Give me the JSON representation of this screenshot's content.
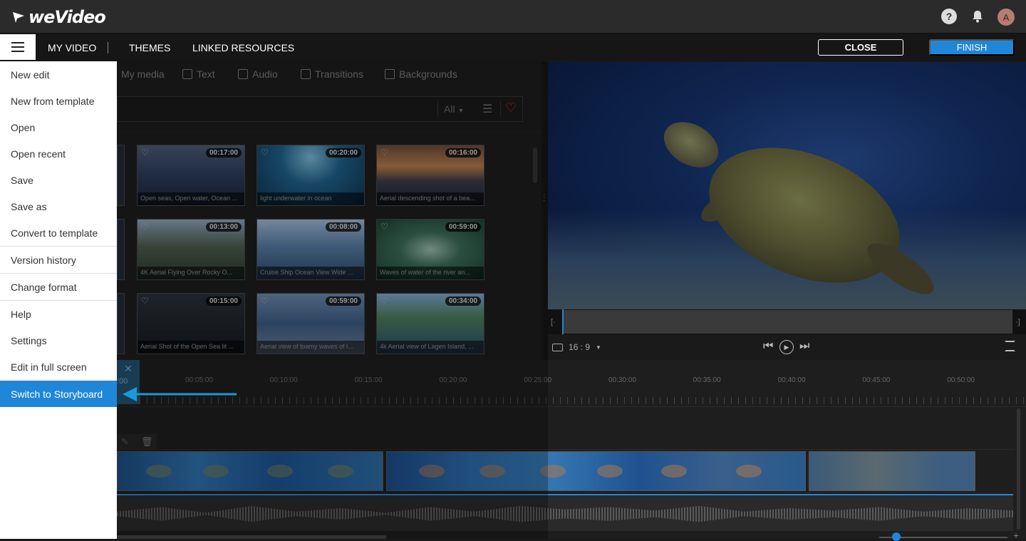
{
  "app": {
    "logo_text": "weVideo"
  },
  "header": {
    "help_icon": "question-circle-icon",
    "help_glyph": "?",
    "bell_icon": "bell-icon",
    "bell_glyph": "🔔",
    "avatar_initial": "A"
  },
  "nav": {
    "items": [
      "MY VIDEO",
      "THEMES",
      "LINKED RESOURCES"
    ],
    "close_label": "CLOSE",
    "finish_label": "FINISH",
    "accent": "#1f86d8"
  },
  "media_tabs": [
    "My media",
    "Text",
    "Audio",
    "Transitions",
    "Backgrounds"
  ],
  "media_filter": {
    "value": "All",
    "favorites_color": "#c0392b"
  },
  "media_items": [
    {
      "duration": "00:17:00",
      "caption": "Open seas, Open water, Ocean ..."
    },
    {
      "duration": "00:20:00",
      "caption": "light underwater in ocean"
    },
    {
      "duration": "00:16:00",
      "caption": "Aerial descending shot of a bea..."
    },
    {
      "duration": "00:13:00",
      "caption": "4K Aerial Flying Over Rocky O..."
    },
    {
      "duration": "00:08:00",
      "caption": "Cruise Ship Ocean View Wide ..."
    },
    {
      "duration": "00:59:00",
      "caption": "Waves of water of the river an..."
    },
    {
      "duration": "00:15:00",
      "caption": "Aerial Shot of the Open Sea lit ..."
    },
    {
      "duration": "00:59:00",
      "caption": "Aerial view of foamy waves of l..."
    },
    {
      "duration": "00:34:00",
      "caption": "4k Aerial view of Lagen Island, ..."
    }
  ],
  "preview": {
    "aspect_ratio": "16 : 9"
  },
  "timeline": {
    "playhead_time": ":00",
    "ticks": [
      "00:05:00",
      "00:10:00",
      "00:15:00",
      "00:20:00",
      "00:25:00",
      "00:30:00",
      "00:35:00",
      "00:40:00",
      "00:45:00",
      "00:50:00"
    ]
  },
  "menu": {
    "items": [
      "New edit",
      "New from template",
      "Open",
      "Open recent",
      "Save",
      "Save as",
      "Convert to template",
      "Version history",
      "Change format",
      "Help",
      "Settings",
      "Edit in full screen",
      "Switch to Storyboard"
    ],
    "active": "Switch to Storyboard",
    "annotation_color": "#1a9ad8"
  }
}
